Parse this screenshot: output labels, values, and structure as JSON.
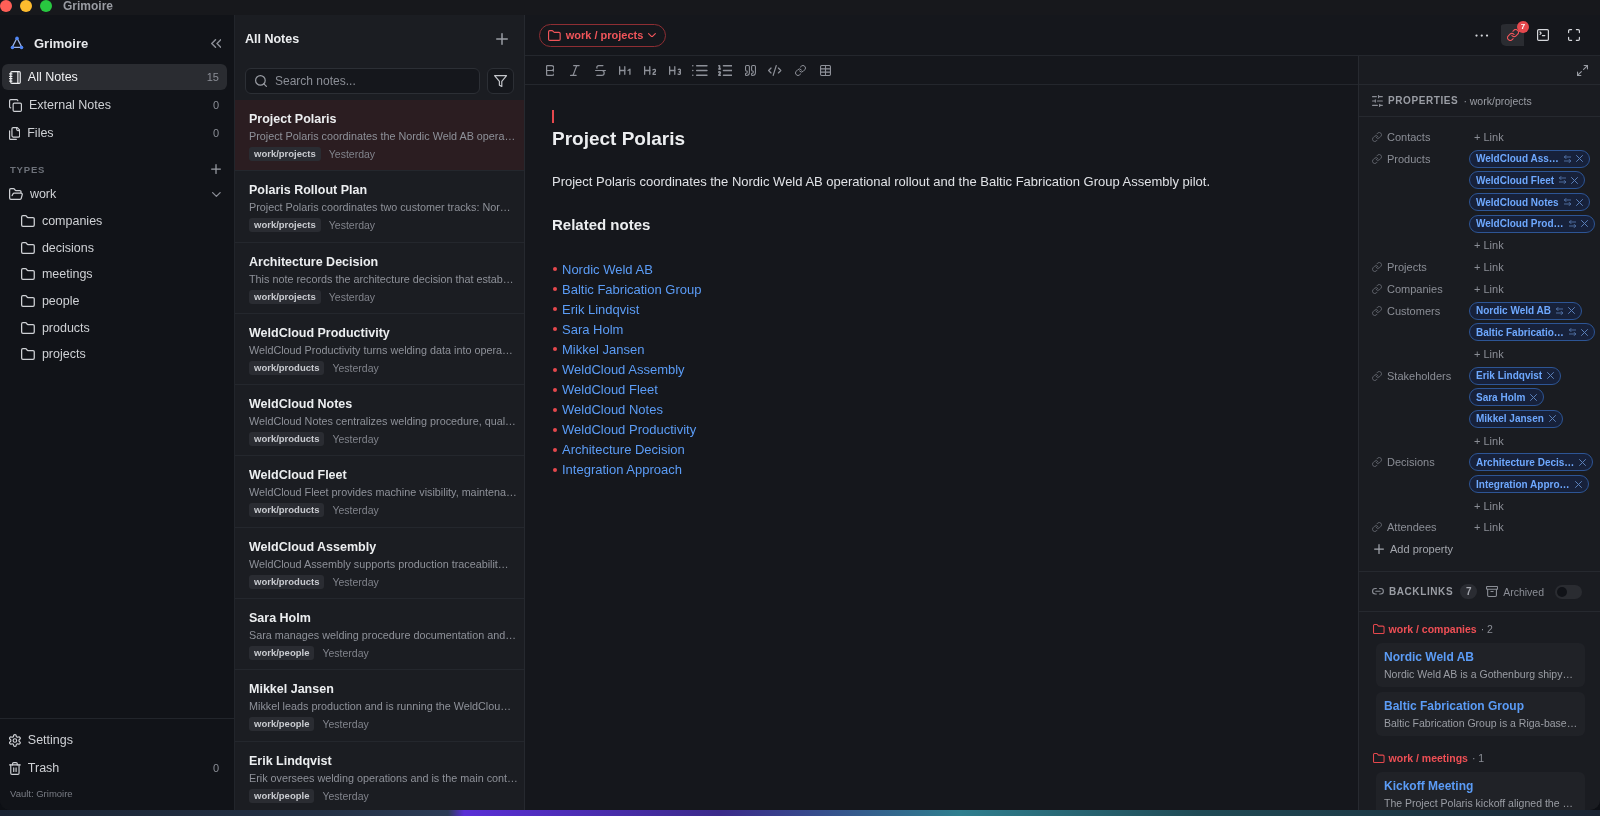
{
  "window": {
    "title": "Grimoire"
  },
  "sidebar": {
    "app_name": "Grimoire",
    "nav": [
      {
        "kind": "notes",
        "label": "All Notes",
        "count": "15",
        "selected": true
      },
      {
        "kind": "external",
        "label": "External Notes",
        "count": "0",
        "selected": false
      },
      {
        "kind": "files",
        "label": "Files",
        "count": "0",
        "selected": false
      }
    ],
    "types_heading": "TYPES",
    "tree": [
      {
        "label": "work",
        "expanded": true,
        "children": [
          {
            "label": "companies"
          },
          {
            "label": "decisions"
          },
          {
            "label": "meetings"
          },
          {
            "label": "people"
          },
          {
            "label": "products"
          },
          {
            "label": "projects"
          }
        ]
      }
    ],
    "footer": [
      {
        "kind": "settings",
        "label": "Settings"
      },
      {
        "kind": "trash",
        "label": "Trash",
        "count": "0"
      }
    ],
    "vault": "Vault: Grimoire"
  },
  "note_list": {
    "title": "All Notes",
    "search": {
      "placeholder": "Search notes..."
    },
    "notes": [
      {
        "title": "Project Polaris",
        "snippet": "Project Polaris coordinates the Nordic Weld AB opera…",
        "tag": "work/projects",
        "date": "Yesterday",
        "selected": true
      },
      {
        "title": "Polaris Rollout Plan",
        "snippet": "Project Polaris coordinates two customer tracks: Nor…",
        "tag": "work/projects",
        "date": "Yesterday",
        "selected": false
      },
      {
        "title": "Architecture Decision",
        "snippet": "This note records the architecture decision that estab…",
        "tag": "work/projects",
        "date": "Yesterday",
        "selected": false
      },
      {
        "title": "WeldCloud Productivity",
        "snippet": "WeldCloud Productivity turns welding data into opera…",
        "tag": "work/products",
        "date": "Yesterday",
        "selected": false
      },
      {
        "title": "WeldCloud Notes",
        "snippet": "WeldCloud Notes centralizes welding procedure, qual…",
        "tag": "work/products",
        "date": "Yesterday",
        "selected": false
      },
      {
        "title": "WeldCloud Fleet",
        "snippet": "WeldCloud Fleet provides machine visibility, maintena…",
        "tag": "work/products",
        "date": "Yesterday",
        "selected": false
      },
      {
        "title": "WeldCloud Assembly",
        "snippet": "WeldCloud Assembly supports production traceabilit…",
        "tag": "work/products",
        "date": "Yesterday",
        "selected": false
      },
      {
        "title": "Sara Holm",
        "snippet": "Sara manages welding procedure documentation and…",
        "tag": "work/people",
        "date": "Yesterday",
        "selected": false
      },
      {
        "title": "Mikkel Jansen",
        "snippet": "Mikkel leads production and is running the WeldClou…",
        "tag": "work/people",
        "date": "Yesterday",
        "selected": false
      },
      {
        "title": "Erik Lindqvist",
        "snippet": "Erik oversees welding operations and is the main cont…",
        "tag": "work/people",
        "date": "Yesterday",
        "selected": false
      }
    ]
  },
  "editor": {
    "breadcrumb": "work / projects",
    "link_badge": "7",
    "document": {
      "title": "Project Polaris",
      "paragraph": "Project Polaris coordinates the Nordic Weld AB operational rollout and the Baltic Fabrication Group Assembly pilot.",
      "heading": "Related notes",
      "related_links": [
        "Nordic Weld AB",
        "Baltic Fabrication Group",
        "Erik Lindqvist",
        "Sara Holm",
        "Mikkel Jansen",
        "WeldCloud Assembly",
        "WeldCloud Fleet",
        "WeldCloud Notes",
        "WeldCloud Productivity",
        "Architecture Decision",
        "Integration Approach"
      ]
    }
  },
  "properties": {
    "heading": "PROPERTIES",
    "type": "· work/projects",
    "rows": [
      {
        "label": "Contacts",
        "add_label": "+ Link"
      },
      {
        "label": "Products",
        "links": [
          {
            "label": "WeldCloud Ass…",
            "bidirectional": true
          },
          {
            "label": "WeldCloud Fleet",
            "bidirectional": true
          },
          {
            "label": "WeldCloud Notes",
            "bidirectional": true
          },
          {
            "label": "WeldCloud Prod…",
            "bidirectional": true
          }
        ],
        "add_label": "+ Link"
      },
      {
        "label": "Projects",
        "add_label": "+ Link"
      },
      {
        "label": "Companies",
        "add_label": "+ Link"
      },
      {
        "label": "Customers",
        "links": [
          {
            "label": "Nordic Weld AB",
            "bidirectional": true
          },
          {
            "label": "Baltic Fabricatio…",
            "bidirectional": true
          }
        ],
        "add_label": "+ Link"
      },
      {
        "label": "Stakeholders",
        "links": [
          {
            "label": "Erik Lindqvist",
            "bidirectional": false
          },
          {
            "label": "Sara Holm",
            "bidirectional": false
          },
          {
            "label": "Mikkel Jansen",
            "bidirectional": false
          }
        ],
        "add_label": "+ Link"
      },
      {
        "label": "Decisions",
        "links": [
          {
            "label": "Architecture Decis…",
            "bidirectional": false
          },
          {
            "label": "Integration Appro…",
            "bidirectional": false
          }
        ],
        "add_label": "+ Link"
      },
      {
        "label": "Attendees",
        "add_label": "+ Link"
      }
    ],
    "add_property": "Add property"
  },
  "backlinks": {
    "heading": "BACKLINKS",
    "count": "7",
    "archived": {
      "label": "Archived",
      "on": false
    },
    "groups": [
      {
        "path": "work / companies",
        "count": "· 2",
        "items": [
          {
            "title": "Nordic Weld AB",
            "snippet": "Nordic Weld AB is a Gothenburg shipy…"
          },
          {
            "title": "Baltic Fabrication Group",
            "snippet": "Baltic Fabrication Group is a Riga-base…"
          }
        ]
      },
      {
        "path": "work / meetings",
        "count": "· 1",
        "items": [
          {
            "title": "Kickoff Meeting",
            "snippet": "The Project Polaris kickoff aligned the …"
          }
        ]
      }
    ]
  }
}
